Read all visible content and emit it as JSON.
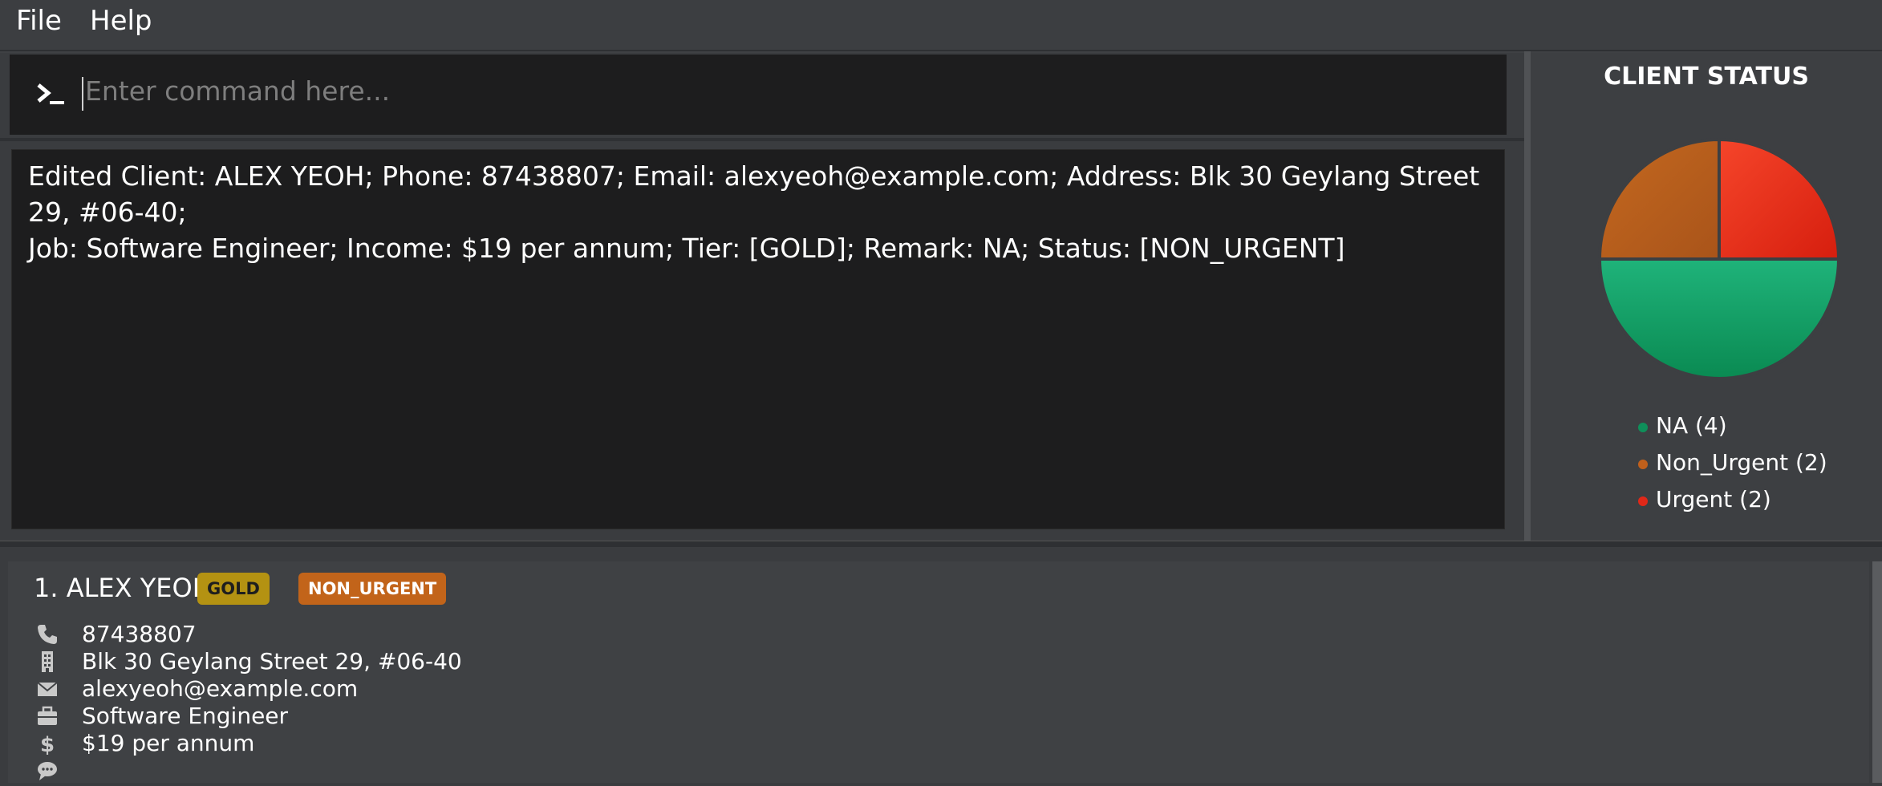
{
  "menu": {
    "file": "File",
    "help": "Help"
  },
  "command": {
    "placeholder": "Enter command here..."
  },
  "result": {
    "message": "Edited Client: ALEX YEOH; Phone: 87438807; Email: alexyeoh@example.com; Address: Blk 30 Geylang Street 29, #06-40;\nJob: Software Engineer; Income: $19 per annum; Tier: [GOLD]; Remark: NA; Status: [NON_URGENT]"
  },
  "client_status": {
    "title": "CLIENT STATUS",
    "legend": [
      {
        "label": "NA (4)",
        "color": "#0f8f5a"
      },
      {
        "label": "Non_Urgent (2)",
        "color": "#c0601c"
      },
      {
        "label": "Urgent (2)",
        "color": "#e02818"
      }
    ]
  },
  "chart_data": {
    "type": "pie",
    "categories": [
      "NA",
      "Non_Urgent",
      "Urgent"
    ],
    "values": [
      4,
      2,
      2
    ],
    "colors": [
      "#0f8f5a",
      "#c0601c",
      "#e02818"
    ],
    "title": "CLIENT STATUS"
  },
  "clients": [
    {
      "index_name": "1. ALEX YEOH",
      "tier": "GOLD",
      "status": "NON_URGENT",
      "phone": "87438807",
      "address": "Blk 30 Geylang Street 29, #06-40",
      "email": "alexyeoh@example.com",
      "job": "Software Engineer",
      "income": "$19 per annum",
      "remark": ""
    }
  ]
}
